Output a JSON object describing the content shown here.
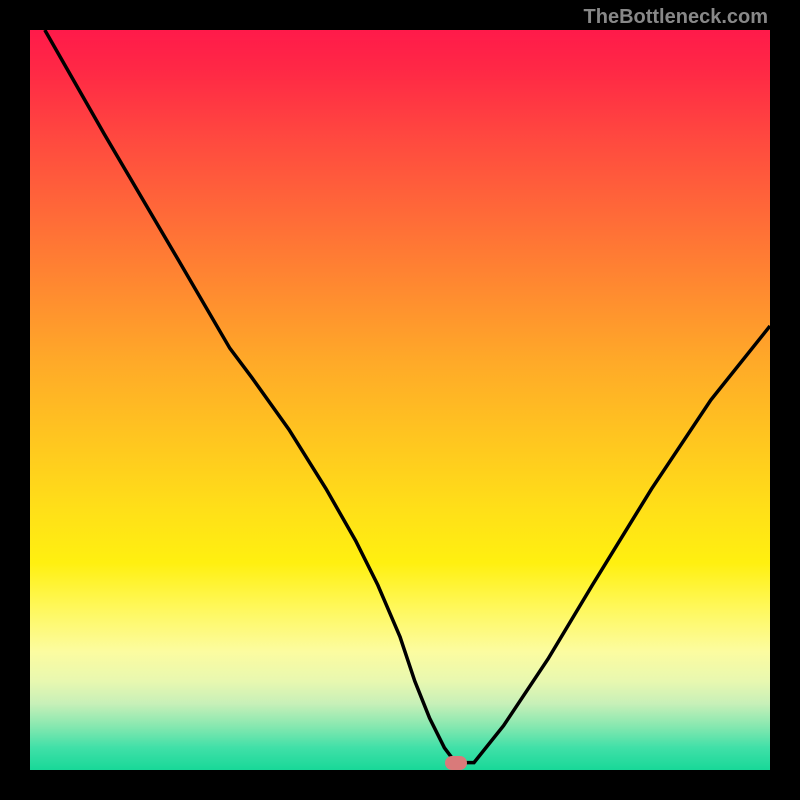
{
  "watermark": "TheBottleneck.com",
  "chart_data": {
    "type": "line",
    "title": "",
    "xlabel": "",
    "ylabel": "",
    "xlim": [
      0,
      100
    ],
    "ylim": [
      0,
      100
    ],
    "series": [
      {
        "name": "bottleneck-curve",
        "x": [
          2,
          10,
          20,
          27,
          30,
          35,
          40,
          44,
          47,
          50,
          52,
          54,
          56,
          57.5,
          60,
          64,
          70,
          76,
          84,
          92,
          100
        ],
        "values": [
          100,
          86,
          69,
          57,
          53,
          46,
          38,
          31,
          25,
          18,
          12,
          7,
          3,
          1,
          1,
          6,
          15,
          25,
          38,
          50,
          60
        ]
      }
    ],
    "marker": {
      "x": 57.5,
      "y": 1
    },
    "gradient_stops": [
      {
        "pos": 0,
        "color": "#ff1a4a"
      },
      {
        "pos": 50,
        "color": "#ffc520"
      },
      {
        "pos": 80,
        "color": "#fff85a"
      },
      {
        "pos": 100,
        "color": "#18d898"
      }
    ]
  }
}
